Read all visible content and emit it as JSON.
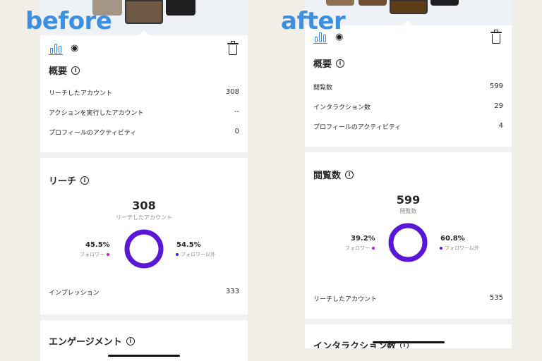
{
  "captions": {
    "before": "before",
    "after": "after"
  },
  "colors": {
    "caption": "#3d8fe0",
    "followers": "#c41ad2",
    "non_followers": "#5a18d6",
    "accent": "#2f8fe0"
  },
  "before": {
    "toolbar": {
      "icons": [
        "bar-chart-icon",
        "eye-icon",
        "trash-icon"
      ]
    },
    "overview": {
      "title": "概要",
      "rows": [
        {
          "label": "リーチしたアカウント",
          "value": "308"
        },
        {
          "label": "アクションを実行したアカウント",
          "value": "--"
        },
        {
          "label": "プロフィールのアクティビティ",
          "value": "0"
        }
      ]
    },
    "reach": {
      "title": "リーチ",
      "big_value": "308",
      "big_label": "リーチしたアカウント",
      "followers_pct": "45.5%",
      "followers_label": "フォロワー",
      "non_followers_pct": "54.5%",
      "non_followers_label": "フォロワー以外",
      "followers_fraction": 0.455,
      "impressions_label": "インプレッション",
      "impressions_value": "333"
    },
    "engagement": {
      "title": "エンゲージメント"
    }
  },
  "after": {
    "toolbar": {
      "icons": [
        "bar-chart-icon",
        "eye-icon",
        "trash-icon"
      ]
    },
    "overview": {
      "title": "概要",
      "rows": [
        {
          "label": "閲覧数",
          "value": "599"
        },
        {
          "label": "インタラクション数",
          "value": "29"
        },
        {
          "label": "プロフィールのアクティビティ",
          "value": "4"
        }
      ]
    },
    "views": {
      "title": "閲覧数",
      "big_value": "599",
      "big_label": "閲覧数",
      "followers_pct": "39.2%",
      "followers_label": "フォロワー",
      "non_followers_pct": "60.8%",
      "non_followers_label": "フォロワー以外",
      "followers_fraction": 0.392,
      "reach_label": "リーチしたアカウント",
      "reach_value": "535"
    },
    "interactions": {
      "title": "インタラクション数"
    }
  }
}
